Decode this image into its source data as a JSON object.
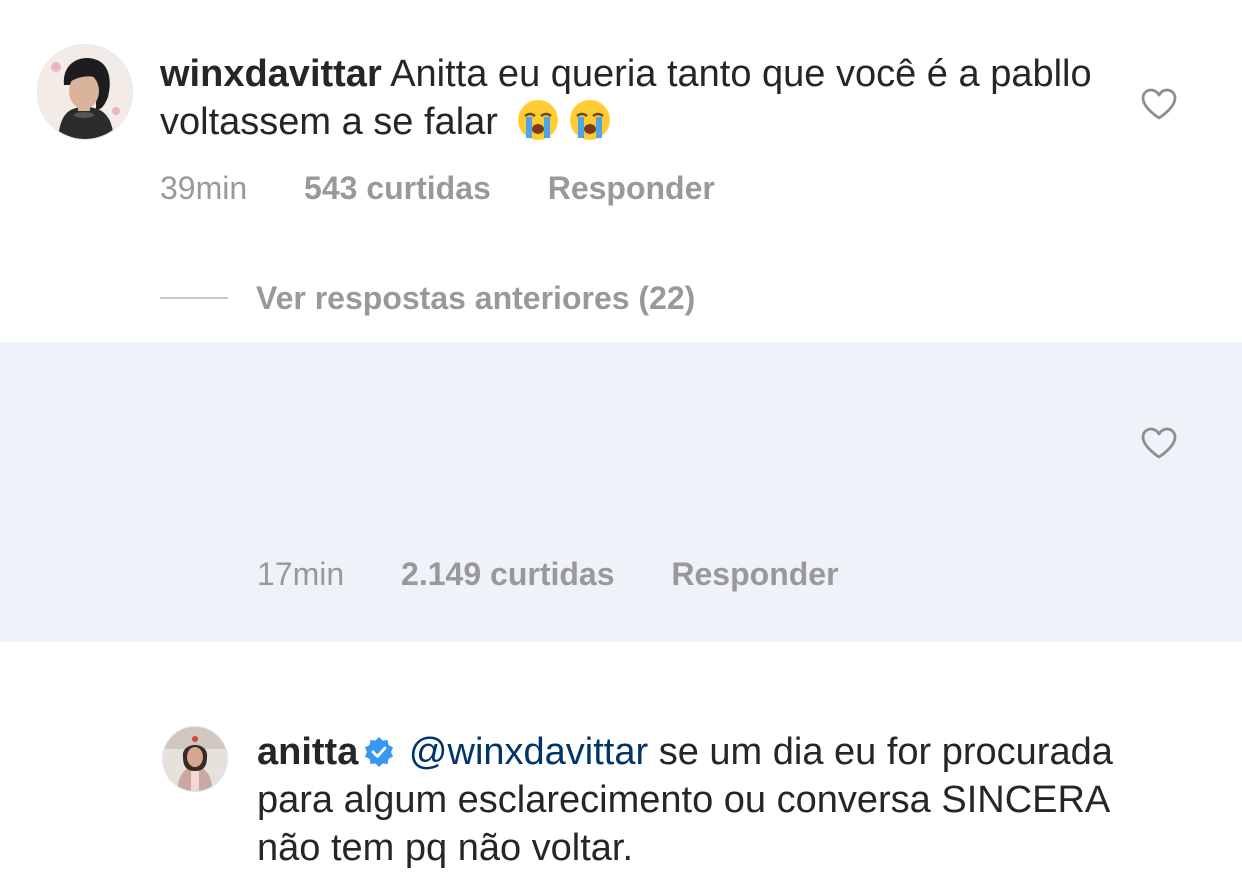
{
  "comments": [
    {
      "username": "winxdavittar",
      "text": "Anitta eu queria tanto que você é a pabllo voltassem a se falar",
      "emojis": [
        "loudly-crying-face-emoji",
        "loudly-crying-face-emoji"
      ],
      "time": "39min",
      "likes": "543 curtidas",
      "reply_label": "Responder"
    },
    {
      "username": "anitta",
      "verified": true,
      "mention": "@winxdavittar",
      "text": "se um dia eu for procurada para algum esclarecimento ou conversa SINCERA não tem pq não voltar.",
      "time": "17min",
      "likes": "2.149 curtidas",
      "reply_label": "Responder"
    }
  ],
  "view_replies": {
    "label": "Ver respostas anteriores (22)"
  },
  "colors": {
    "text": "#262626",
    "meta": "#999999",
    "mention": "#003569",
    "verified": "#3897f0",
    "highlight_bg": "#eff3f9"
  }
}
